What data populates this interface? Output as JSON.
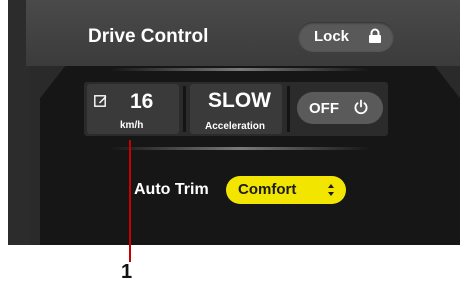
{
  "header": {
    "title": "Drive Control",
    "lock_label": "Lock"
  },
  "status": {
    "speed_value": "16",
    "speed_unit": "km/h",
    "acceleration_value": "SLOW",
    "acceleration_label": "Acceleration",
    "power_label": "OFF"
  },
  "trim": {
    "label": "Auto Trim",
    "selected": "Comfort"
  },
  "callout": {
    "number": "1"
  },
  "colors": {
    "accent": "#f2e600",
    "callout": "#c80000",
    "panel": "#161616"
  },
  "icons": [
    "lock-icon",
    "edit-icon",
    "power-icon",
    "updown-arrows-icon"
  ]
}
